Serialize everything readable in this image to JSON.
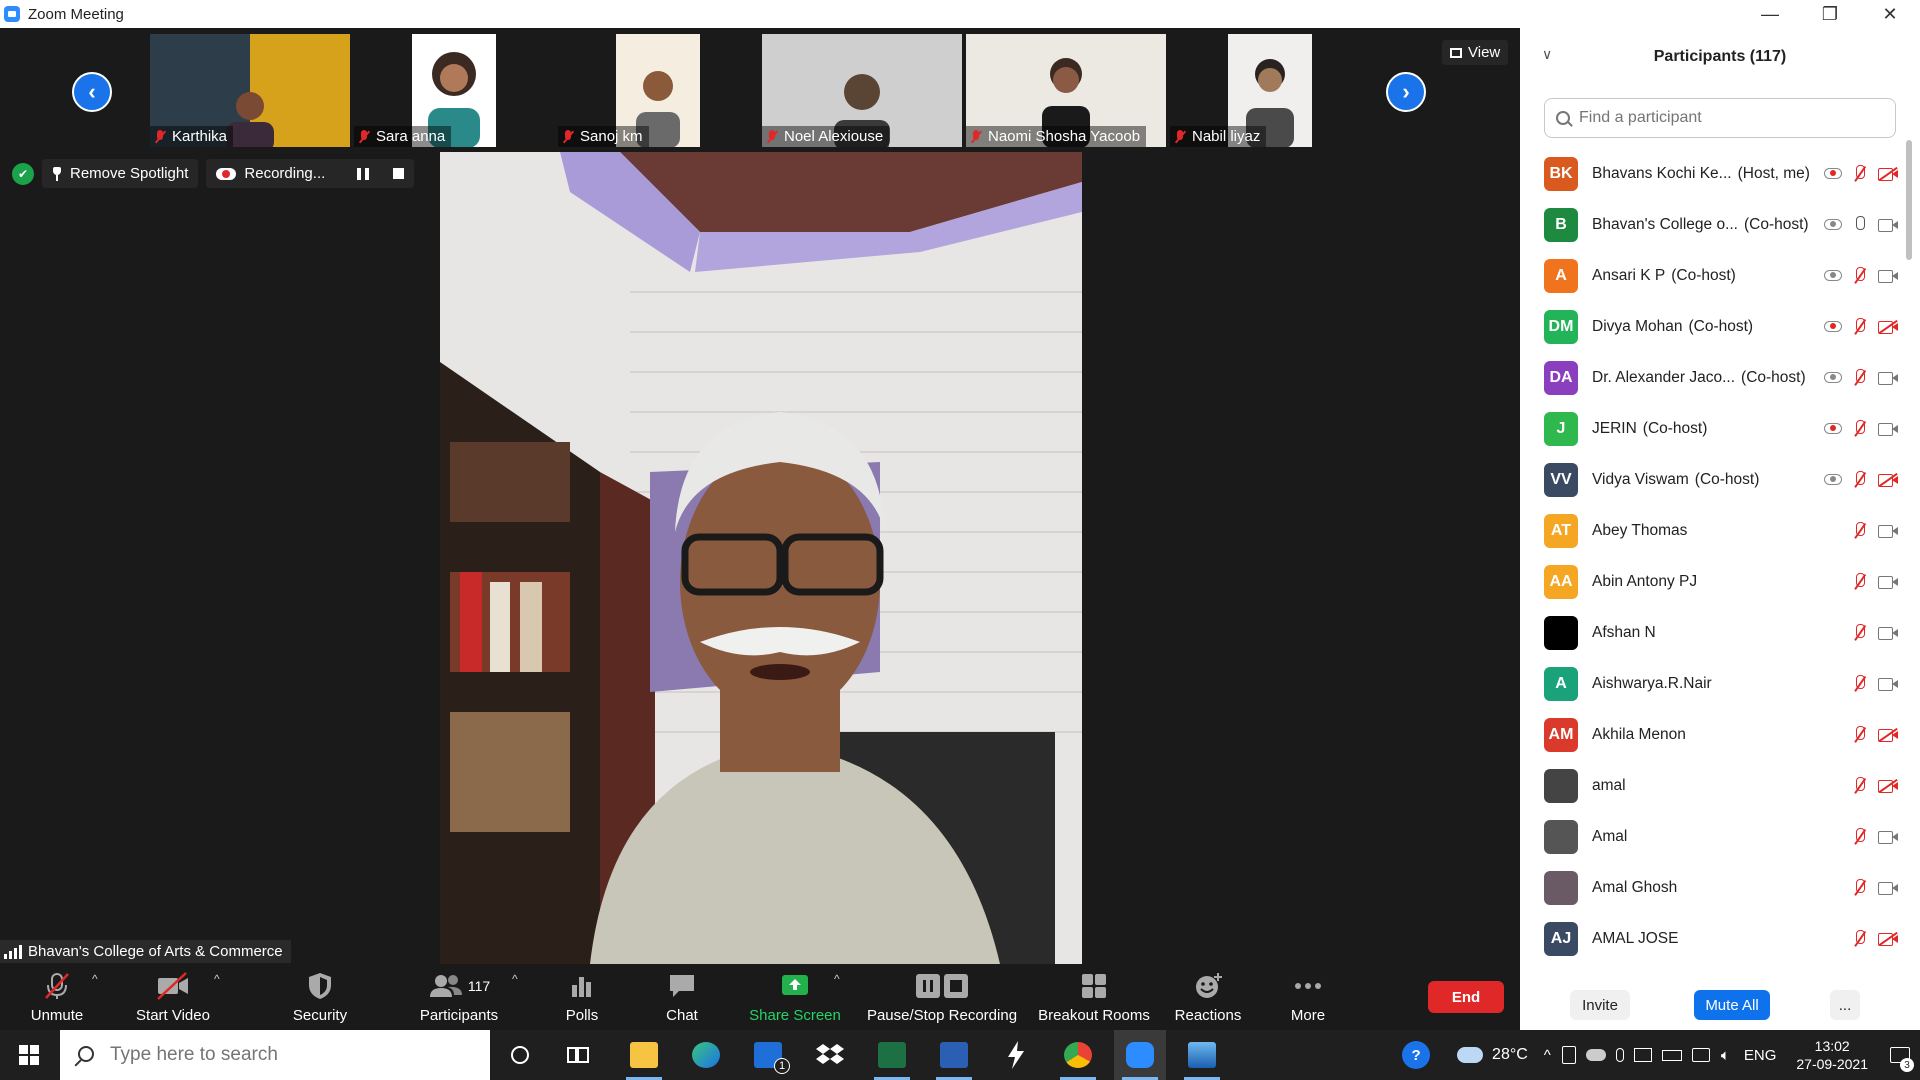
{
  "window": {
    "title": "Zoom Meeting",
    "minimize_glyph": "—",
    "restore_glyph": "❐",
    "close_glyph": "✕"
  },
  "thumbnails": [
    {
      "name": "Karthika",
      "bg": "#d7a21b"
    },
    {
      "name": "Sara anna",
      "bg": "#ffffff"
    },
    {
      "name": "Sanoj km",
      "bg": "#f4ede0"
    },
    {
      "name": "Noel Alexiouse",
      "bg": "#cfcfcf"
    },
    {
      "name": "Naomi Shosha Yacoob",
      "bg": "#ece8e2"
    },
    {
      "name": "Nabil liyaz",
      "bg": "#f0efee"
    }
  ],
  "view_label": "View",
  "spotlight": {
    "remove_label": "Remove Spotlight",
    "recording_label": "Recording..."
  },
  "speaker_name": "Bhavan's College of Arts & Commerce",
  "toolbar": {
    "unmute": "Unmute",
    "start_video": "Start Video",
    "security": "Security",
    "participants": "Participants",
    "participants_count": "117",
    "polls": "Polls",
    "chat": "Chat",
    "share_screen": "Share Screen",
    "pause_stop_recording": "Pause/Stop Recording",
    "breakout_rooms": "Breakout Rooms",
    "reactions": "Reactions",
    "more": "More",
    "end": "End"
  },
  "panel": {
    "title": "Participants (117)",
    "search_placeholder": "Find a participant",
    "participants": [
      {
        "initials": "BK",
        "color": "#d9591e",
        "name": "Bhavans Kochi Ke...",
        "role": "(Host, me)",
        "cloud": "red",
        "mic": "off",
        "cam": "off"
      },
      {
        "initials": "B",
        "color": "#1e8a3f",
        "name": "Bhavan's College o...",
        "role": "(Co-host)",
        "cloud": "grey",
        "mic": "on",
        "cam": "on"
      },
      {
        "initials": "A",
        "color": "#f0741e",
        "name": "Ansari K P",
        "role": "(Co-host)",
        "cloud": "grey",
        "mic": "off",
        "cam": "on"
      },
      {
        "initials": "DM",
        "color": "#23b45a",
        "name": "Divya Mohan",
        "role": "(Co-host)",
        "cloud": "red",
        "mic": "off",
        "cam": "off"
      },
      {
        "initials": "DA",
        "color": "#8a3fbf",
        "name": "Dr. Alexander Jaco...",
        "role": "(Co-host)",
        "cloud": "grey",
        "mic": "off",
        "cam": "on"
      },
      {
        "initials": "J",
        "color": "#2fb84e",
        "name": "JERIN",
        "role": "(Co-host)",
        "cloud": "red",
        "mic": "off",
        "cam": "on"
      },
      {
        "initials": "VV",
        "color": "#3b4a63",
        "name": "Vidya Viswam",
        "role": "(Co-host)",
        "cloud": "grey",
        "mic": "off",
        "cam": "off"
      },
      {
        "initials": "AT",
        "color": "#f5a623",
        "name": "Abey Thomas",
        "role": "",
        "cloud": "none",
        "mic": "off",
        "cam": "on"
      },
      {
        "initials": "AA",
        "color": "#f5a623",
        "name": "Abin Antony PJ",
        "role": "",
        "cloud": "none",
        "mic": "off",
        "cam": "on"
      },
      {
        "initials": "",
        "color": "#000000",
        "name": "Afshan N",
        "role": "",
        "cloud": "none",
        "mic": "off",
        "cam": "on"
      },
      {
        "initials": "A",
        "color": "#1aa37a",
        "name": "Aishwarya.R.Nair",
        "role": "",
        "cloud": "none",
        "mic": "off",
        "cam": "on"
      },
      {
        "initials": "AM",
        "color": "#d93a2b",
        "name": "Akhila Menon",
        "role": "",
        "cloud": "none",
        "mic": "off",
        "cam": "off"
      },
      {
        "initials": "",
        "color": "#444444",
        "name": "amal",
        "role": "",
        "cloud": "none",
        "mic": "off",
        "cam": "off"
      },
      {
        "initials": "",
        "color": "#555555",
        "name": "Amal",
        "role": "",
        "cloud": "none",
        "mic": "off",
        "cam": "on"
      },
      {
        "initials": "",
        "color": "#6a5a66",
        "name": "Amal Ghosh",
        "role": "",
        "cloud": "none",
        "mic": "off",
        "cam": "on"
      },
      {
        "initials": "AJ",
        "color": "#3b4a63",
        "name": "AMAL JOSE",
        "role": "",
        "cloud": "none",
        "mic": "off",
        "cam": "off"
      }
    ],
    "invite": "Invite",
    "mute_all": "Mute All",
    "more": "..."
  },
  "taskbar": {
    "search_placeholder": "Type here to search",
    "weather": "28°C",
    "language": "ENG",
    "time": "13:02",
    "date": "27-09-2021",
    "notification_count": "3",
    "mail_badge": "1"
  }
}
